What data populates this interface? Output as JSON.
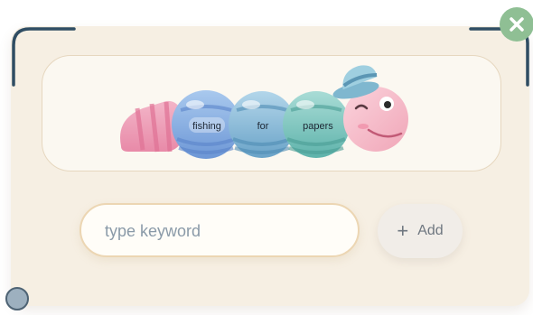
{
  "window": {
    "close_icon": "close-icon"
  },
  "banner": {
    "segments": [
      "fishing",
      "for",
      "papers"
    ]
  },
  "search": {
    "placeholder": "type keyword",
    "value": ""
  },
  "add_button": {
    "label": "Add",
    "icon": "plus-icon"
  },
  "colors": {
    "card": "#f6efe3",
    "frame_accent": "#2f4d63",
    "close_button": "#8fbf94",
    "input_border": "#ecd6b3"
  }
}
